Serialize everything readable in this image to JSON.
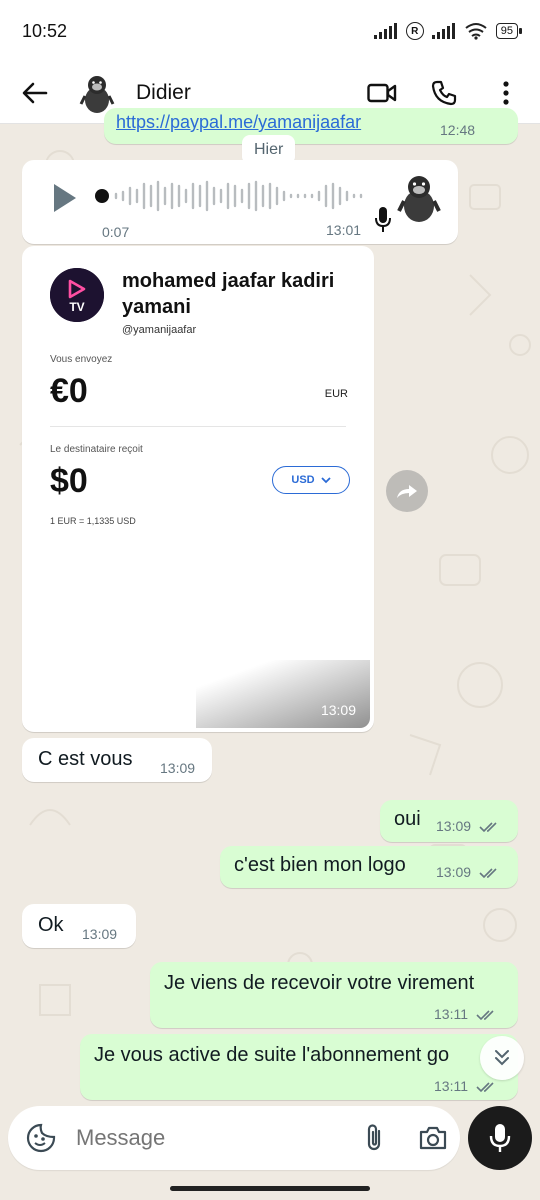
{
  "status_bar": {
    "time": "10:52",
    "battery": "95"
  },
  "header": {
    "contact_name": "Didier"
  },
  "top_partial": {
    "link_text": "https://paypal.me/yamanijaafar",
    "time": "12:48"
  },
  "date_chip": "Hier",
  "voice_message": {
    "duration": "0:07",
    "time": "13:01"
  },
  "payment_card": {
    "name": "mohamed jaafar kadiri yamani",
    "handle": "@yamanijaafar",
    "logo_text": "TV",
    "send_label": "Vous envoyez",
    "send_amount": "€0",
    "send_currency": "EUR",
    "receive_label": "Le destinataire reçoit",
    "receive_amount": "$0",
    "receive_currency": "USD",
    "rate": "1 EUR = 1,1335 USD",
    "time": "13:09"
  },
  "messages": [
    {
      "direction": "in",
      "text": "C est vous",
      "time": "13:09"
    },
    {
      "direction": "out",
      "text": "oui",
      "time": "13:09"
    },
    {
      "direction": "out",
      "text": "c'est bien mon logo",
      "time": "13:09"
    },
    {
      "direction": "in",
      "text": "Ok",
      "time": "13:09"
    },
    {
      "direction": "out",
      "text": "Je viens de recevoir votre virement",
      "time": "13:11"
    },
    {
      "direction": "out",
      "text": "Je vous active de suite l'abonnement go",
      "time": "13:11"
    }
  ],
  "composer": {
    "placeholder": "Message"
  },
  "colors": {
    "outgoing": "#d9fdd3",
    "incoming": "#ffffff",
    "tick": "#667781",
    "accent": "#2b6bd6"
  }
}
